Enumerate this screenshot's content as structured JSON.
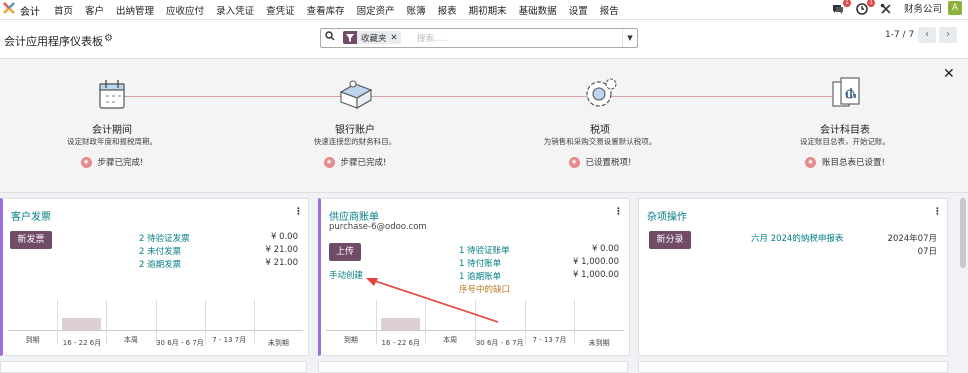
{
  "nav": {
    "app_name": "会计",
    "menu": [
      "首页",
      "客户",
      "出纳管理",
      "应收应付",
      "录入凭证",
      "查凭证",
      "查看库存",
      "固定资产",
      "账簿",
      "报表",
      "期初期末",
      "基础数据",
      "设置",
      "报告"
    ],
    "chat_badge": "1",
    "activity_badge": "1",
    "company": "财务公司",
    "avatar": "A",
    "icons": [
      "chat-icon",
      "clock-icon",
      "tools-icon"
    ]
  },
  "control": {
    "title": "会计应用程序仪表板",
    "facet_label": "收藏夹",
    "search_placeholder": "搜索.....",
    "pager": "1-7 / 7"
  },
  "onboarding": {
    "steps": [
      {
        "title": "会计期间",
        "desc": "设定财政年度和报税周期。",
        "status": "步骤已完成!"
      },
      {
        "title": "银行账户",
        "desc": "快速连接您的财务科目。",
        "status": "步骤已完成!"
      },
      {
        "title": "税项",
        "desc": "为销售和采购交易设置默认税项。",
        "status": "已设置税项!"
      },
      {
        "title": "会计科目表",
        "desc": "设定账目总表，开始记账。",
        "status": "账目总表已设置!"
      }
    ]
  },
  "cards": {
    "customer": {
      "title": "客户发票",
      "button": "新发票",
      "lines": [
        {
          "label": "2 待验证发票",
          "amount": "¥ 0.00"
        },
        {
          "label": "2 未付发票",
          "amount": "¥ 21.00"
        },
        {
          "label": "2 逾期发票",
          "amount": "¥ 21.00"
        }
      ],
      "ticks": [
        "到期",
        "16 - 22 6月",
        "本周",
        "30 6月 - 6 7月",
        "7 - 13 7月",
        "未到期"
      ],
      "chart_values": [
        0,
        1,
        0,
        0,
        0,
        0
      ]
    },
    "vendor": {
      "title": "供应商账单",
      "email": "purchase-6@odoo.com",
      "button": "上传",
      "manual": "手动创建",
      "lines": [
        {
          "label": "1 待验证账单",
          "amount": "¥ 0.00"
        },
        {
          "label": "1 待付账单",
          "amount": "¥ 1,000.00"
        },
        {
          "label": "1 逾期账单",
          "amount": "¥ 1,000.00"
        }
      ],
      "gap_warning": "序号中的缺口",
      "ticks": [
        "到期",
        "16 - 22 6月",
        "本周",
        "30 6月 - 6 7月",
        "7 - 13 7月",
        "未到期"
      ],
      "chart_values": [
        0,
        1,
        0,
        0,
        0,
        0
      ]
    },
    "misc": {
      "title": "杂项操作",
      "button": "新分录",
      "entry_label": "六月 2024的纳税申报表",
      "entry_date_1": "2024年07月",
      "entry_date_2": "07日"
    }
  },
  "colors": {
    "brand": "#714b67",
    "link": "#017e84",
    "accent_border": "#9c6ee2",
    "arrow": "#e8413b"
  }
}
